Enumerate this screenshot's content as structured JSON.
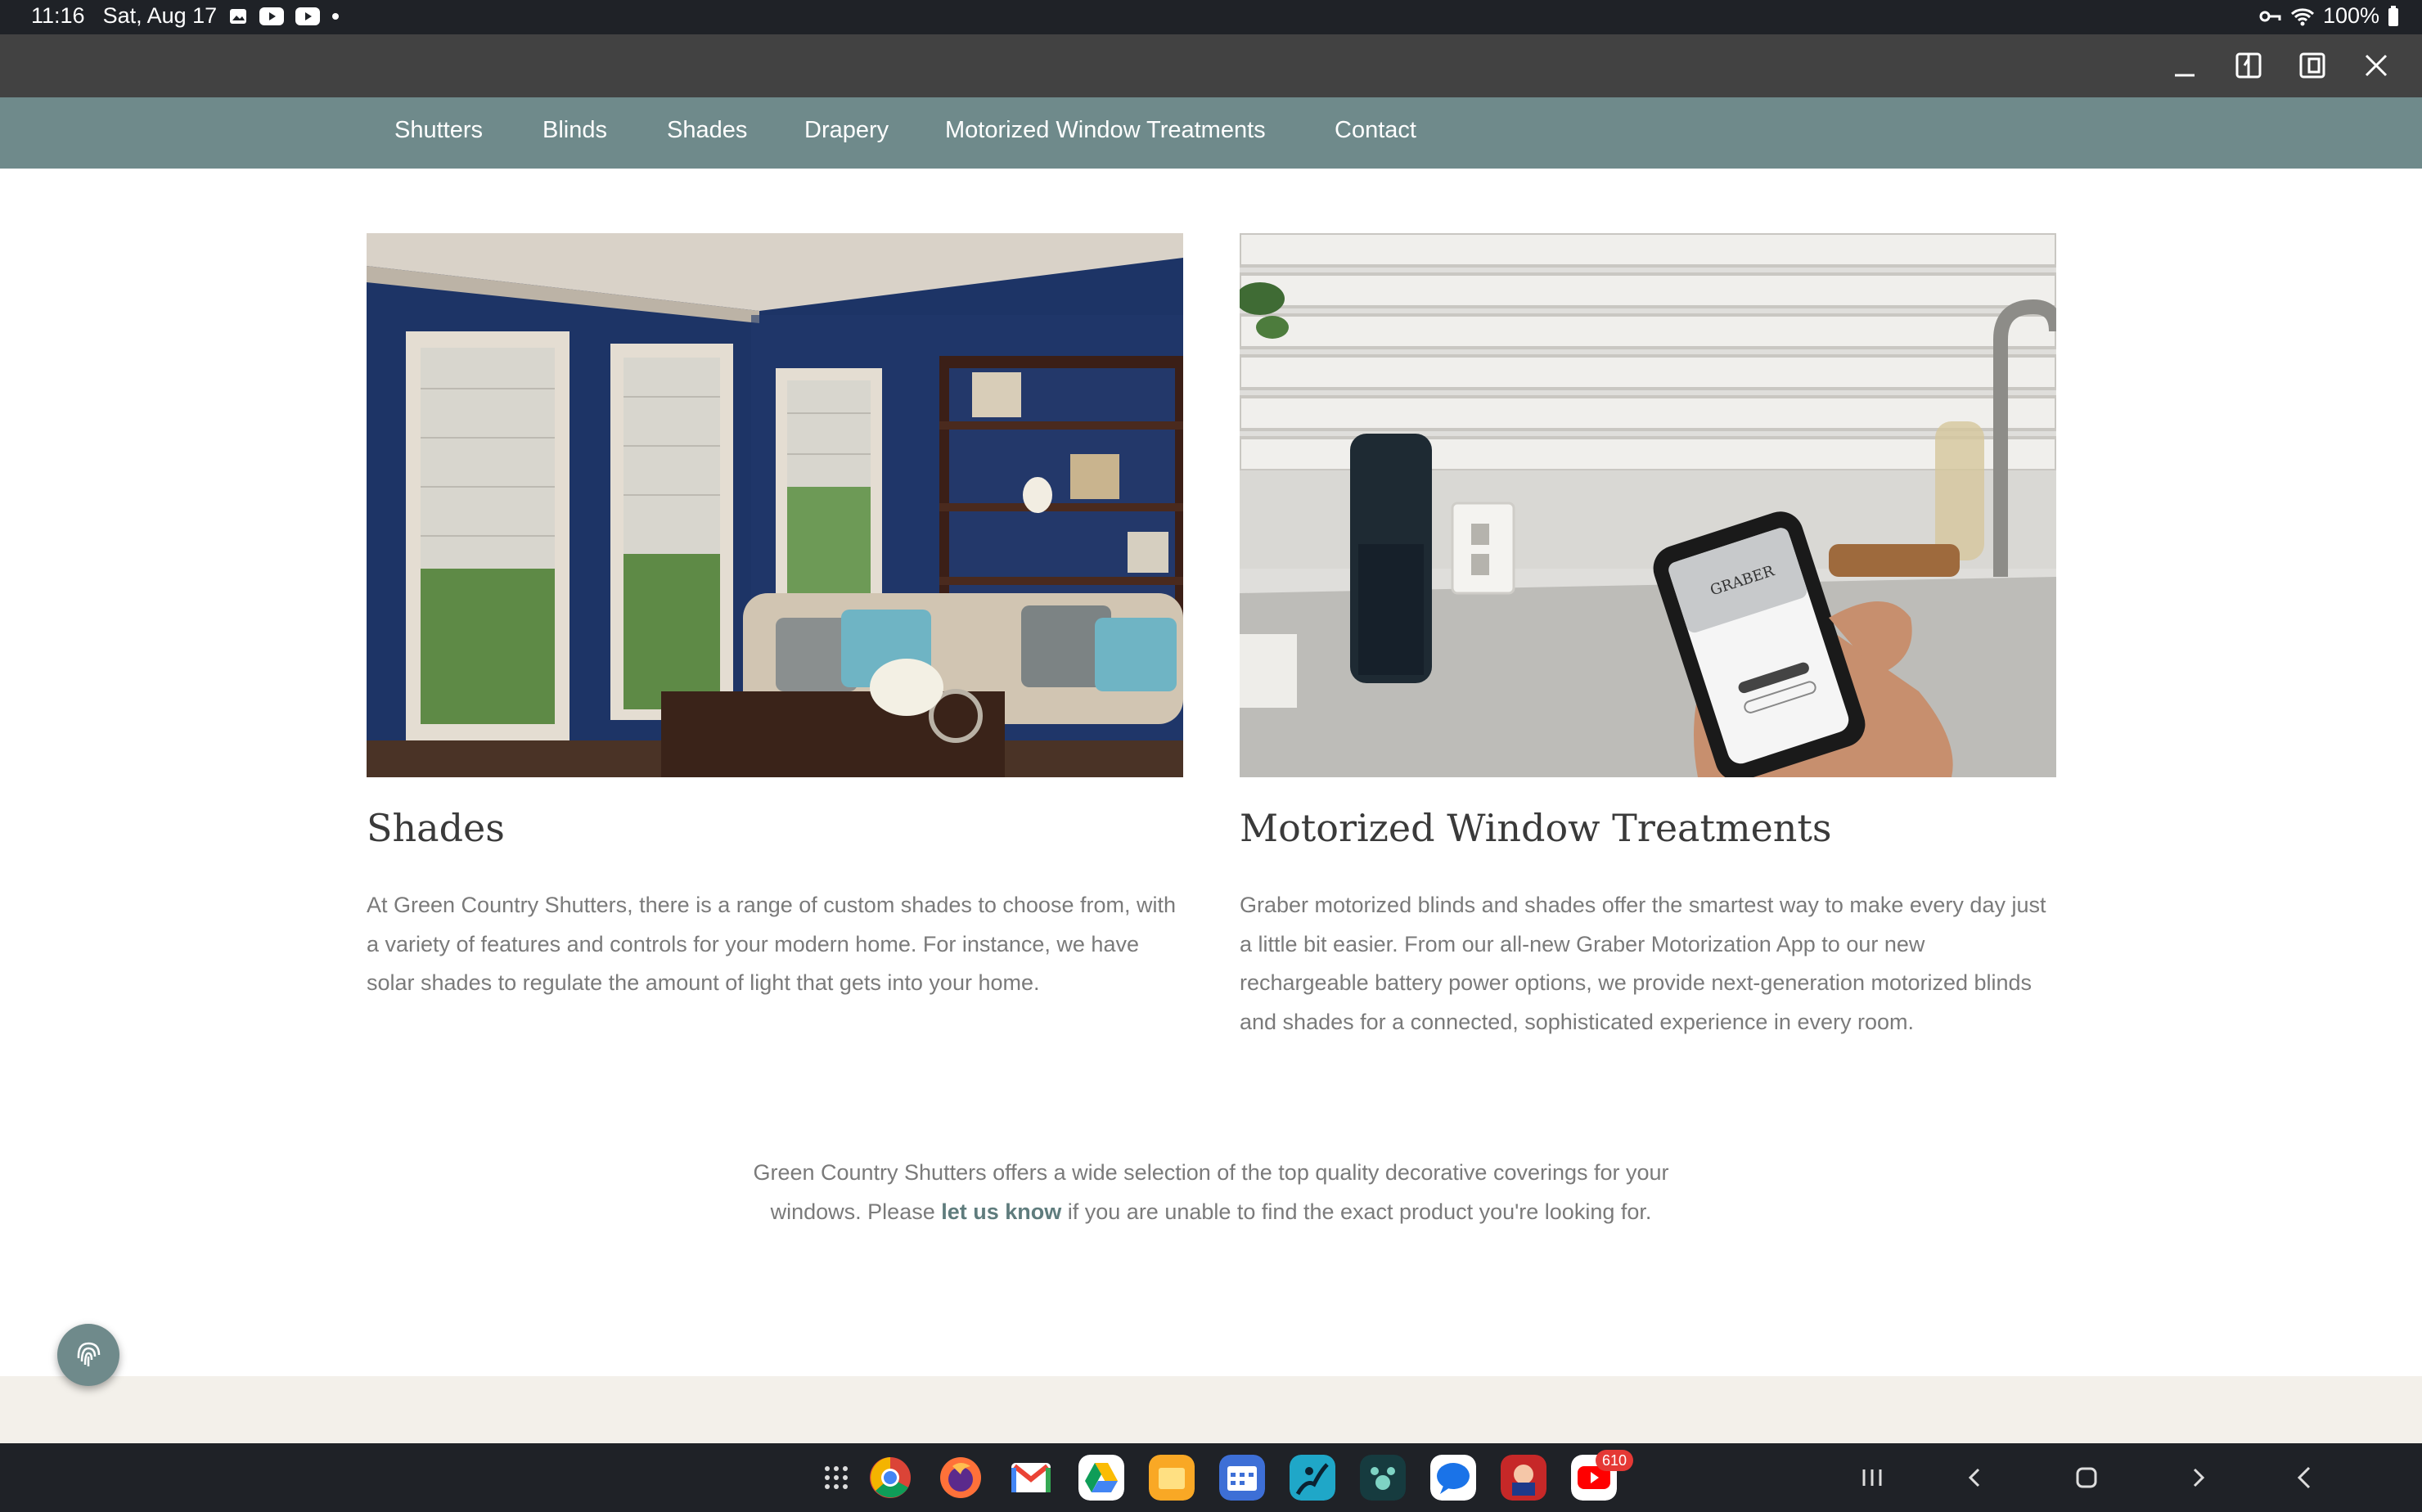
{
  "status_bar": {
    "time": "11:16",
    "date": "Sat, Aug 17",
    "battery": "100%",
    "icons": [
      "gallery-icon",
      "youtube-icon",
      "youtube-icon",
      "dot-icon",
      "vpn-key-icon",
      "wifi-icon",
      "battery-icon"
    ]
  },
  "window_controls": [
    "minimize-icon",
    "split-view-icon",
    "popup-view-icon",
    "close-icon"
  ],
  "nav": {
    "items": [
      "Shutters",
      "Blinds",
      "Shades",
      "Drapery",
      "Motorized Window Treatments",
      "Contact"
    ]
  },
  "cards": [
    {
      "title": "Shades",
      "body": "At Green Country Shutters, there is a range of custom shades to choose from, with a variety of features and controls for your modern home. For instance, we have solar shades to regulate the amount of light that gets into your home."
    },
    {
      "title": "Motorized Window Treatments",
      "body": "Graber motorized blinds and shades offer the smartest way to make every day just a little bit easier. From our all-new Graber Motorization App to our new rechargeable battery power options, we provide next-generation motorized blinds and shades for a connected, sophisticated experience in every room.",
      "image_text": "GRABER"
    }
  ],
  "footer": {
    "line1": "Green Country Shutters offers a wide selection of the top quality decorative coverings for your",
    "line2_before": "windows. Please ",
    "link": "let us know",
    "line2_after": " if you are unable to find the exact product you're looking for."
  },
  "taskbar": {
    "apps": [
      "app-drawer-icon",
      "chrome-icon",
      "firefox-icon",
      "gmail-icon",
      "drive-icon",
      "files-icon",
      "calendar-icon",
      "kindle-icon",
      "pawprint-app-icon",
      "messages-icon",
      "game-app-icon",
      "youtube-icon"
    ],
    "youtube_badge": "610"
  },
  "colors": {
    "nav": "#6f8a8b",
    "accent_link": "#5f7c7d",
    "footer_band": "#f3f0ea"
  }
}
